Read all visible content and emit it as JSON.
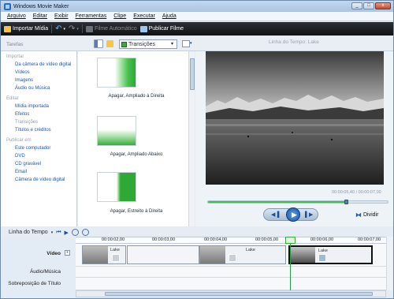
{
  "window": {
    "title": "Windows Movie Maker",
    "buttons": [
      "_",
      "□",
      "x"
    ]
  },
  "menu": [
    "Arquivo",
    "Editar",
    "Exibir",
    "Ferramentas",
    "Clipe",
    "Executar",
    "Ajuda"
  ],
  "toolbar": {
    "import": "Importar Mídia",
    "auto_movie": "Filme Automático",
    "publish": "Publicar Filme"
  },
  "tasks": {
    "header": "Tarefas",
    "groups": [
      {
        "title": "Importar",
        "items": [
          "Da câmera de vídeo digital",
          "Vídeos",
          "Imagens",
          "Áudio ou Música"
        ]
      },
      {
        "title": "Editar",
        "items": [
          "Mídia importada",
          "Efeitos",
          "Transições",
          "Títulos e créditos"
        ]
      },
      {
        "title": "Publicar em",
        "items": [
          "Este computador",
          "DVD",
          "CD gravável",
          "Email",
          "Câmera de vídeo digital"
        ]
      }
    ]
  },
  "collection": {
    "selected": "Transições",
    "arrow": "▾"
  },
  "transitions": [
    "Apagar, Ampliado à Direita",
    "Apagar, Ampliado Abaixo",
    "Apagar, Estreito à Direita"
  ],
  "preview": {
    "title": "Linha do Tempo: Lake",
    "time": "00:00:05,40 / 00:00:07,00",
    "progress": 0.77,
    "split": "Dividir"
  },
  "timeline": {
    "label": "Linha do Tempo",
    "ruler": [
      "00:00:02,00",
      "00:00:03,00",
      "00:00:04,00",
      "00:00:05,00",
      "00:00:06,00",
      "00:00:07,00"
    ],
    "tracks": {
      "video": "Vídeo",
      "audio": "Áudio/Música",
      "title": "Sobreposição de Título"
    },
    "clips": [
      "Lake",
      "Lake",
      "Lake"
    ]
  }
}
